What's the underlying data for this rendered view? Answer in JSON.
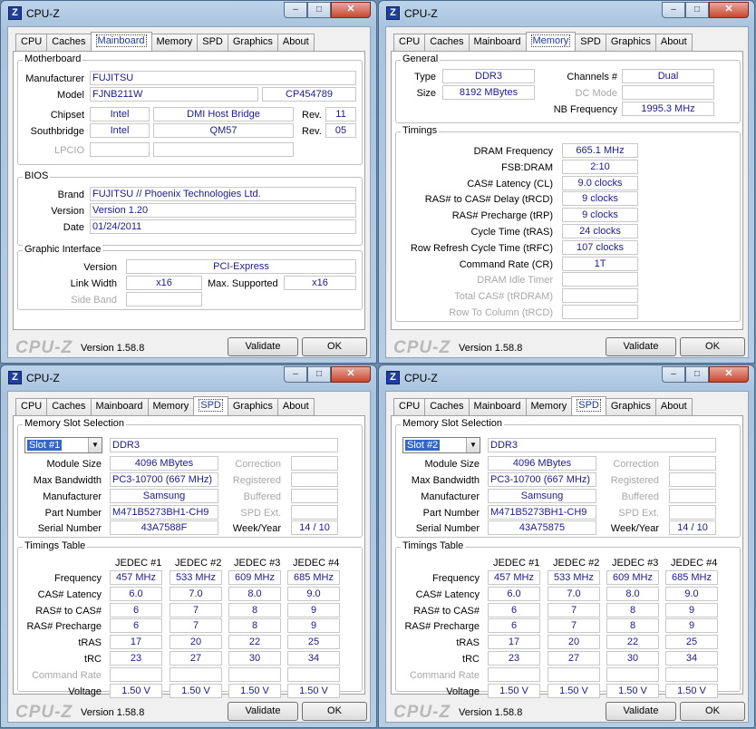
{
  "app": {
    "title": "CPU-Z",
    "logo": "CPU-Z",
    "version": "Version 1.58.8",
    "validate": "Validate",
    "ok": "OK"
  },
  "tabs": [
    "CPU",
    "Caches",
    "Mainboard",
    "Memory",
    "SPD",
    "Graphics",
    "About"
  ],
  "mainboard": {
    "motherboard": {
      "legend": "Motherboard",
      "manufacturer_label": "Manufacturer",
      "manufacturer": "FUJITSU",
      "model_label": "Model",
      "model": "FJNB211W",
      "model_rev": "CP454789",
      "chipset_label": "Chipset",
      "chipset_vendor": "Intel",
      "chipset_name": "DMI Host Bridge",
      "rev_label": "Rev.",
      "chipset_rev": "11",
      "southbridge_label": "Southbridge",
      "south_vendor": "Intel",
      "south_name": "QM57",
      "south_rev": "05",
      "lpcio_label": "LPCIO"
    },
    "bios": {
      "legend": "BIOS",
      "brand_label": "Brand",
      "brand": "FUJITSU // Phoenix Technologies Ltd.",
      "version_label": "Version",
      "version": "Version 1.20",
      "date_label": "Date",
      "date": "01/24/2011"
    },
    "graphic": {
      "legend": "Graphic Interface",
      "version_label": "Version",
      "version": "PCI-Express",
      "linkwidth_label": "Link Width",
      "linkwidth": "x16",
      "maxsup_label": "Max. Supported",
      "maxsup": "x16",
      "sideband_label": "Side Band"
    }
  },
  "memory": {
    "general": {
      "legend": "General",
      "type_label": "Type",
      "type": "DDR3",
      "size_label": "Size",
      "size": "8192 MBytes",
      "channels_label": "Channels #",
      "channels": "Dual",
      "dcmode_label": "DC Mode",
      "nbfreq_label": "NB Frequency",
      "nbfreq": "1995.3 MHz"
    },
    "timings": {
      "legend": "Timings",
      "rows": [
        {
          "label": "DRAM Frequency",
          "value": "665.1 MHz"
        },
        {
          "label": "FSB:DRAM",
          "value": "2:10"
        },
        {
          "label": "CAS# Latency (CL)",
          "value": "9.0 clocks"
        },
        {
          "label": "RAS# to CAS# Delay (tRCD)",
          "value": "9 clocks"
        },
        {
          "label": "RAS# Precharge (tRP)",
          "value": "9 clocks"
        },
        {
          "label": "Cycle Time (tRAS)",
          "value": "24 clocks"
        },
        {
          "label": "Row Refresh Cycle Time (tRFC)",
          "value": "107 clocks"
        },
        {
          "label": "Command Rate (CR)",
          "value": "1T"
        },
        {
          "label": "DRAM Idle Timer",
          "value": ""
        },
        {
          "label": "Total CAS# (tRDRAM)",
          "value": ""
        },
        {
          "label": "Row To Column (tRCD)",
          "value": ""
        }
      ]
    }
  },
  "spd_labels": {
    "slot_legend": "Memory Slot Selection",
    "module_size": "Module Size",
    "max_bw": "Max Bandwidth",
    "manufacturer": "Manufacturer",
    "part": "Part Number",
    "serial": "Serial Number",
    "correction": "Correction",
    "registered": "Registered",
    "buffered": "Buffered",
    "spd_ext": "SPD Ext.",
    "weekyear": "Week/Year",
    "timings_legend": "Timings Table",
    "rows": [
      "Frequency",
      "CAS# Latency",
      "RAS# to CAS#",
      "RAS# Precharge",
      "tRAS",
      "tRC",
      "Command Rate",
      "Voltage"
    ],
    "cols": [
      "JEDEC #1",
      "JEDEC #2",
      "JEDEC #3",
      "JEDEC #4"
    ]
  },
  "spd1": {
    "slot": "Slot #1",
    "type": "DDR3",
    "module_size": "4096 MBytes",
    "max_bw": "PC3-10700 (667 MHz)",
    "manufacturer": "Samsung",
    "part": "M471B5273BH1-CH9",
    "serial": "43A7588F",
    "weekyear": "14 / 10",
    "table": [
      [
        "457 MHz",
        "533 MHz",
        "609 MHz",
        "685 MHz"
      ],
      [
        "6.0",
        "7.0",
        "8.0",
        "9.0"
      ],
      [
        "6",
        "7",
        "8",
        "9"
      ],
      [
        "6",
        "7",
        "8",
        "9"
      ],
      [
        "17",
        "20",
        "22",
        "25"
      ],
      [
        "23",
        "27",
        "30",
        "34"
      ],
      [
        "",
        "",
        "",
        ""
      ],
      [
        "1.50 V",
        "1.50 V",
        "1.50 V",
        "1.50 V"
      ]
    ]
  },
  "spd2": {
    "slot": "Slot #2",
    "type": "DDR3",
    "module_size": "4096 MBytes",
    "max_bw": "PC3-10700 (667 MHz)",
    "manufacturer": "Samsung",
    "part": "M471B5273BH1-CH9",
    "serial": "43A75875",
    "weekyear": "14 / 10",
    "table": [
      [
        "457 MHz",
        "533 MHz",
        "609 MHz",
        "685 MHz"
      ],
      [
        "6.0",
        "7.0",
        "8.0",
        "9.0"
      ],
      [
        "6",
        "7",
        "8",
        "9"
      ],
      [
        "6",
        "7",
        "8",
        "9"
      ],
      [
        "17",
        "20",
        "22",
        "25"
      ],
      [
        "23",
        "27",
        "30",
        "34"
      ],
      [
        "",
        "",
        "",
        ""
      ],
      [
        "1.50 V",
        "1.50 V",
        "1.50 V",
        "1.50 V"
      ]
    ]
  },
  "window_icons": {
    "minimize": "minimize-icon",
    "maximize": "maximize-icon",
    "close": "close-icon"
  }
}
